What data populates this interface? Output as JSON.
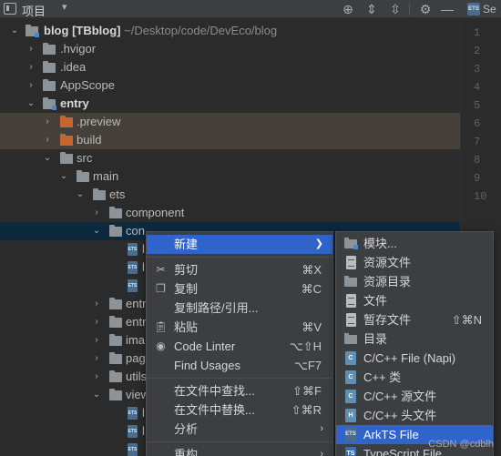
{
  "toolbar": {
    "title": "项目",
    "icons": [
      "view-icon",
      "caret-down-icon",
      "locate-icon",
      "expand-all-icon",
      "collapse-all-icon",
      "gear-icon",
      "minimize-icon"
    ]
  },
  "editor": {
    "tab_label": "Se",
    "tab_icon_text": "ETS",
    "line_numbers": [
      "1",
      "2",
      "3",
      "4",
      "5",
      "6",
      "7",
      "8",
      "9",
      "10"
    ]
  },
  "tree": {
    "root": {
      "name": "blog",
      "tag": "[TBblog]",
      "path": "~/Desktop/code/DevEco/blog"
    },
    "rows": [
      {
        "label": ".hvigor"
      },
      {
        "label": ".idea"
      },
      {
        "label": "AppScope"
      },
      {
        "label": "entry"
      },
      {
        "label": ".preview"
      },
      {
        "label": "build"
      },
      {
        "label": "src"
      },
      {
        "label": "main"
      },
      {
        "label": "ets"
      },
      {
        "label": "component"
      },
      {
        "label": "con"
      },
      {
        "label": "l"
      },
      {
        "label": "l"
      },
      {
        "label": ""
      },
      {
        "label": "entr"
      },
      {
        "label": "entr"
      },
      {
        "label": "ima"
      },
      {
        "label": "pag"
      },
      {
        "label": "utils"
      },
      {
        "label": "view"
      },
      {
        "label": "l"
      },
      {
        "label": "l"
      },
      {
        "label": ""
      }
    ],
    "file_icon_text": "ETS"
  },
  "context_menu": {
    "items": [
      {
        "label": "新建",
        "shortcut": ""
      },
      {
        "label": "剪切",
        "shortcut": "⌘X"
      },
      {
        "label": "复制",
        "shortcut": "⌘C"
      },
      {
        "label": "复制路径/引用...",
        "shortcut": ""
      },
      {
        "label": "粘贴",
        "shortcut": "⌘V"
      },
      {
        "label": "Code Linter",
        "shortcut": "⌥⇧H"
      },
      {
        "label": "Find Usages",
        "shortcut": "⌥F7"
      },
      {
        "label": "在文件中查找...",
        "shortcut": "⇧⌘F"
      },
      {
        "label": "在文件中替换...",
        "shortcut": "⇧⌘R"
      },
      {
        "label": "分析",
        "shortcut": ""
      },
      {
        "label": "重构",
        "shortcut": ""
      }
    ]
  },
  "submenu": {
    "items": [
      {
        "label": "模块...",
        "shortcut": ""
      },
      {
        "label": "资源文件",
        "shortcut": ""
      },
      {
        "label": "资源目录",
        "shortcut": ""
      },
      {
        "label": "文件",
        "shortcut": ""
      },
      {
        "label": "暂存文件",
        "shortcut": "⇧⌘N"
      },
      {
        "label": "目录",
        "shortcut": ""
      },
      {
        "label": "C/C++ File (Napi)",
        "shortcut": ""
      },
      {
        "label": "C++ 类",
        "shortcut": ""
      },
      {
        "label": "C/C++ 源文件",
        "shortcut": ""
      },
      {
        "label": "C/C++ 头文件",
        "shortcut": ""
      },
      {
        "label": "ArkTS File",
        "shortcut": ""
      },
      {
        "label": "TypeScript File",
        "shortcut": ""
      }
    ],
    "icon_texts": {
      "cpp_napi": "C",
      "cpp_class": "C",
      "c_source": "C",
      "c_header": "H",
      "arkts": "ETS",
      "typescript": "TS"
    }
  },
  "watermark": "CSDN @cdblh",
  "colors": {
    "background": "#2b2b2b",
    "panel": "#3c3f41",
    "excluded_row": "#45413a",
    "selected_row": "#0d293e",
    "menu_highlight": "#2f65ca",
    "excluded_folder": "#c7652e"
  }
}
